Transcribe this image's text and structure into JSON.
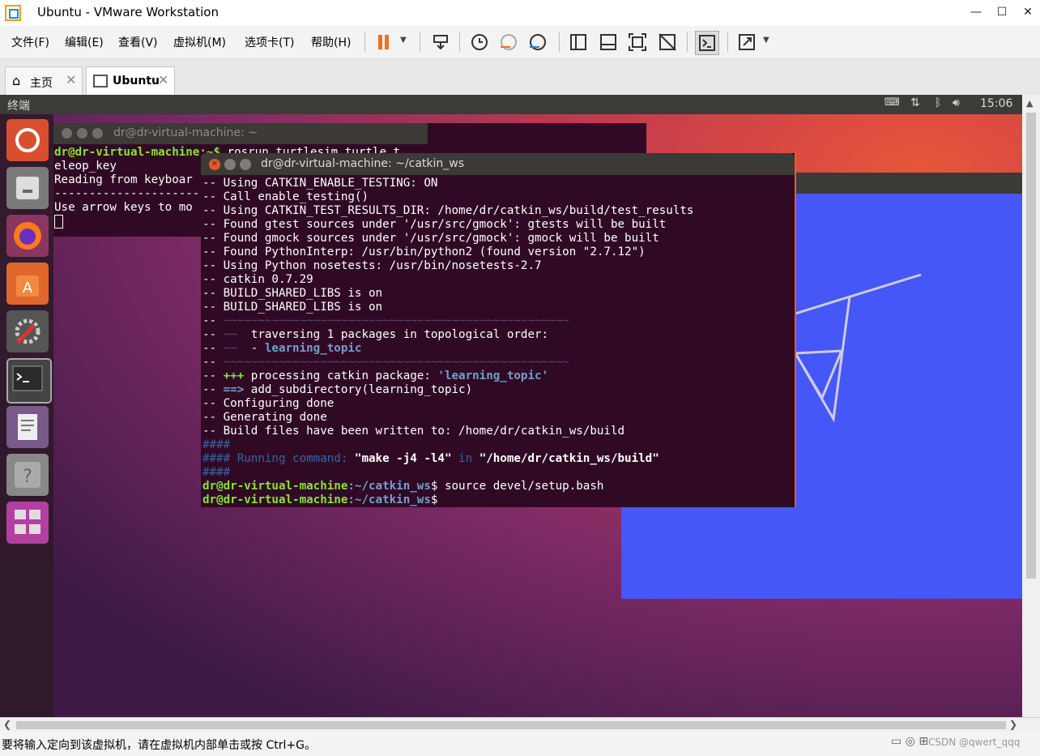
{
  "window": {
    "title": "Ubuntu - VMware Workstation"
  },
  "menu": [
    "文件(F)",
    "编辑(E)",
    "查看(V)",
    "虚拟机(M)",
    "选项卡(T)",
    "帮助(H)"
  ],
  "tabs": [
    {
      "label": "主页"
    },
    {
      "label": "Ubuntu"
    }
  ],
  "ubuntu_topbar": {
    "app_name": "终端",
    "time": "15:06"
  },
  "back_terminal": {
    "title": "dr@dr-virtual-machine: ~",
    "lines": [
      {
        "prompt": "dr@dr-virtual-machine:~$",
        "text": " rosrun turtlesim turtle_t"
      },
      {
        "text": "eleop_key"
      },
      {
        "text": "Reading from keyboar"
      },
      {
        "text": "---------------------"
      },
      {
        "text": "Use arrow keys to mo"
      }
    ]
  },
  "front_terminal": {
    "title": "dr@dr-virtual-machine: ~/catkin_ws",
    "lines": [
      "-- Using CATKIN_ENABLE_TESTING: ON",
      "-- Call enable_testing()",
      "-- Using CATKIN_TEST_RESULTS_DIR: /home/dr/catkin_ws/build/test_results",
      "-- Found gtest sources under '/usr/src/gmock': gtests will be built",
      "-- Found gmock sources under '/usr/src/gmock': gmock will be built",
      "-- Found PythonInterp: /usr/bin/python2 (found version \"2.7.12\")",
      "-- Using Python nosetests: /usr/bin/nosetests-2.7",
      "-- catkin 0.7.29",
      "-- BUILD_SHARED_LIBS is on",
      "-- BUILD_SHARED_LIBS is on"
    ],
    "sep1": "~~~~~~~~~~~~~~~~~~~~~~~~~~~~~~~~~~~~~~~~~~~~~~~~~~",
    "traversing": "traversing 1 packages in topological order:",
    "package": "learning_topic",
    "sep2": "~~~~~~~~~~~~~~~~~~~~~~~~~~~~~~~~~~~~~~~~~~~~~~~~~~",
    "processing_prefix": "processing catkin package: ",
    "processing_pkg": "'learning_topic'",
    "add_subdir": "add_subdirectory(learning_topic)",
    "configuring": "-- Configuring done",
    "generating": "-- Generating done",
    "build_files": "-- Build files have been written to: /home/dr/catkin_ws/build",
    "hash1": "####",
    "running_label": "#### Running command: ",
    "running_cmd": "\"make -j4 -l4\"",
    "running_in": " in ",
    "running_dir": "\"/home/dr/catkin_ws/build\"",
    "hash2": "####",
    "prompt_user": "dr@dr-virtual-machine",
    "prompt_path": ":~/catkin_ws",
    "prompt_dollar": "$",
    "cmd1": " source devel/setup.bash"
  },
  "status": {
    "message": "要将输入定向到该虚拟机，请在虚拟机内部单击或按 Ctrl+G。",
    "watermark": "CSDN @qwert_qqq"
  }
}
